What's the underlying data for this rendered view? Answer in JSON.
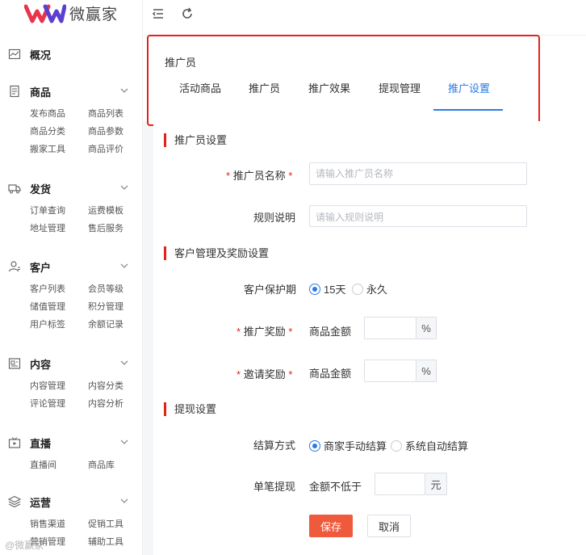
{
  "brand": {
    "name": "微赢家"
  },
  "sidebar": {
    "overview": {
      "label": "概况",
      "icon": "chart-line-icon"
    },
    "groups": [
      {
        "label": "商品",
        "icon": "document-icon",
        "items": [
          "发布商品",
          "商品列表",
          "商品分类",
          "商品参数",
          "搬家工具",
          "商品评价"
        ]
      },
      {
        "label": "发货",
        "icon": "truck-icon",
        "items": [
          "订单查询",
          "运费模板",
          "地址管理",
          "售后服务"
        ]
      },
      {
        "label": "客户",
        "icon": "user-icon",
        "items": [
          "客户列表",
          "会员等级",
          "储值管理",
          "积分管理",
          "用户标签",
          "余额记录"
        ]
      },
      {
        "label": "内容",
        "icon": "content-icon",
        "items": [
          "内容管理",
          "内容分类",
          "评论管理",
          "内容分析"
        ]
      },
      {
        "label": "直播",
        "icon": "tv-icon",
        "items": [
          "直播间",
          "商品库"
        ]
      },
      {
        "label": "运营",
        "icon": "layers-icon",
        "items": [
          "销售渠道",
          "促销工具",
          "营销管理",
          "辅助工具"
        ]
      }
    ]
  },
  "topbar": {
    "collapse_icon": "menu-collapse-icon",
    "refresh_icon": "refresh-icon"
  },
  "page": {
    "crumb": "推广员",
    "tabs": [
      "活动商品",
      "推广员",
      "推广效果",
      "提现管理",
      "推广设置"
    ],
    "active_tab": "推广设置"
  },
  "form": {
    "section1": "推广员设置",
    "name_label": "推广员名称",
    "name_placeholder": "请输入推广员名称",
    "rule_label": "规则说明",
    "rule_placeholder": "请输入规则说明",
    "section2": "客户管理及奖励设置",
    "protect_label": "客户保护期",
    "protect_options": [
      "15天",
      "永久"
    ],
    "protect_selected": "15天",
    "promote_label": "推广奖励",
    "promote_prefix": "商品金额",
    "promote_suffix": "%",
    "invite_label": "邀请奖励",
    "invite_prefix": "商品金额",
    "invite_suffix": "%",
    "section3": "提现设置",
    "settle_label": "结算方式",
    "settle_options": [
      "商家手动结算",
      "系统自动结算"
    ],
    "settle_selected": "商家手动结算",
    "single_label": "单笔提现",
    "single_prefix": "金额不低于",
    "single_suffix": "元",
    "save": "保存",
    "cancel": "取消",
    "required_mark": "*"
  },
  "watermark": "@微赢家",
  "colors": {
    "accent": "#2b7be4",
    "danger": "#e0231b",
    "save": "#f05a3c"
  }
}
